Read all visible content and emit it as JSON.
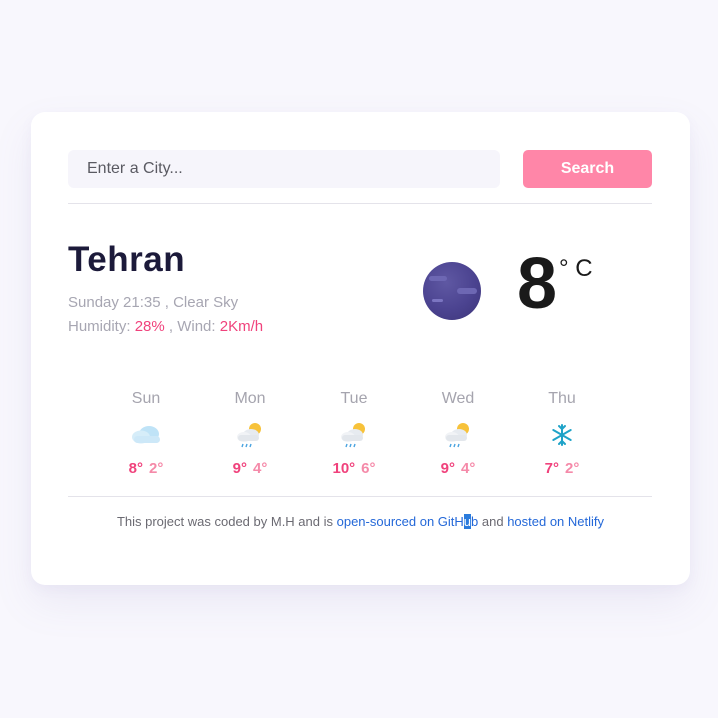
{
  "search": {
    "placeholder": "Enter a City...",
    "button_label": "Search"
  },
  "current": {
    "city": "Tehran",
    "day_time": "Sunday 21:35",
    "separator": " , ",
    "description": "Clear Sky",
    "humidity_label": "Humidity: ",
    "humidity_value": "28%",
    "wind_label": " , Wind: ",
    "wind_value": "2Km/h",
    "temperature": "8",
    "unit": "° C",
    "icon": "night-clear-moon-icon"
  },
  "forecast": [
    {
      "day": "Sun",
      "icon": "cloud-icon",
      "max": "8°",
      "min": "2°"
    },
    {
      "day": "Mon",
      "icon": "sun-cloud-rain-icon",
      "max": "9°",
      "min": "4°"
    },
    {
      "day": "Tue",
      "icon": "sun-cloud-rain-icon",
      "max": "10°",
      "min": "6°"
    },
    {
      "day": "Wed",
      "icon": "sun-cloud-rain-icon",
      "max": "9°",
      "min": "4°"
    },
    {
      "day": "Thu",
      "icon": "snowflake-icon",
      "max": "7°",
      "min": "2°"
    }
  ],
  "footer": {
    "text_1": "This project was coded by M.H and is ",
    "link_1_a": "open-sourced on GitH",
    "link_1_sel": "u",
    "link_1_b": "b",
    "text_2": " and ",
    "link_2": "hosted on Netlify"
  },
  "colors": {
    "accent_pink": "#ff86a8",
    "highlight": "#f0427c",
    "link": "#2468d8",
    "title": "#1c1a3a"
  }
}
